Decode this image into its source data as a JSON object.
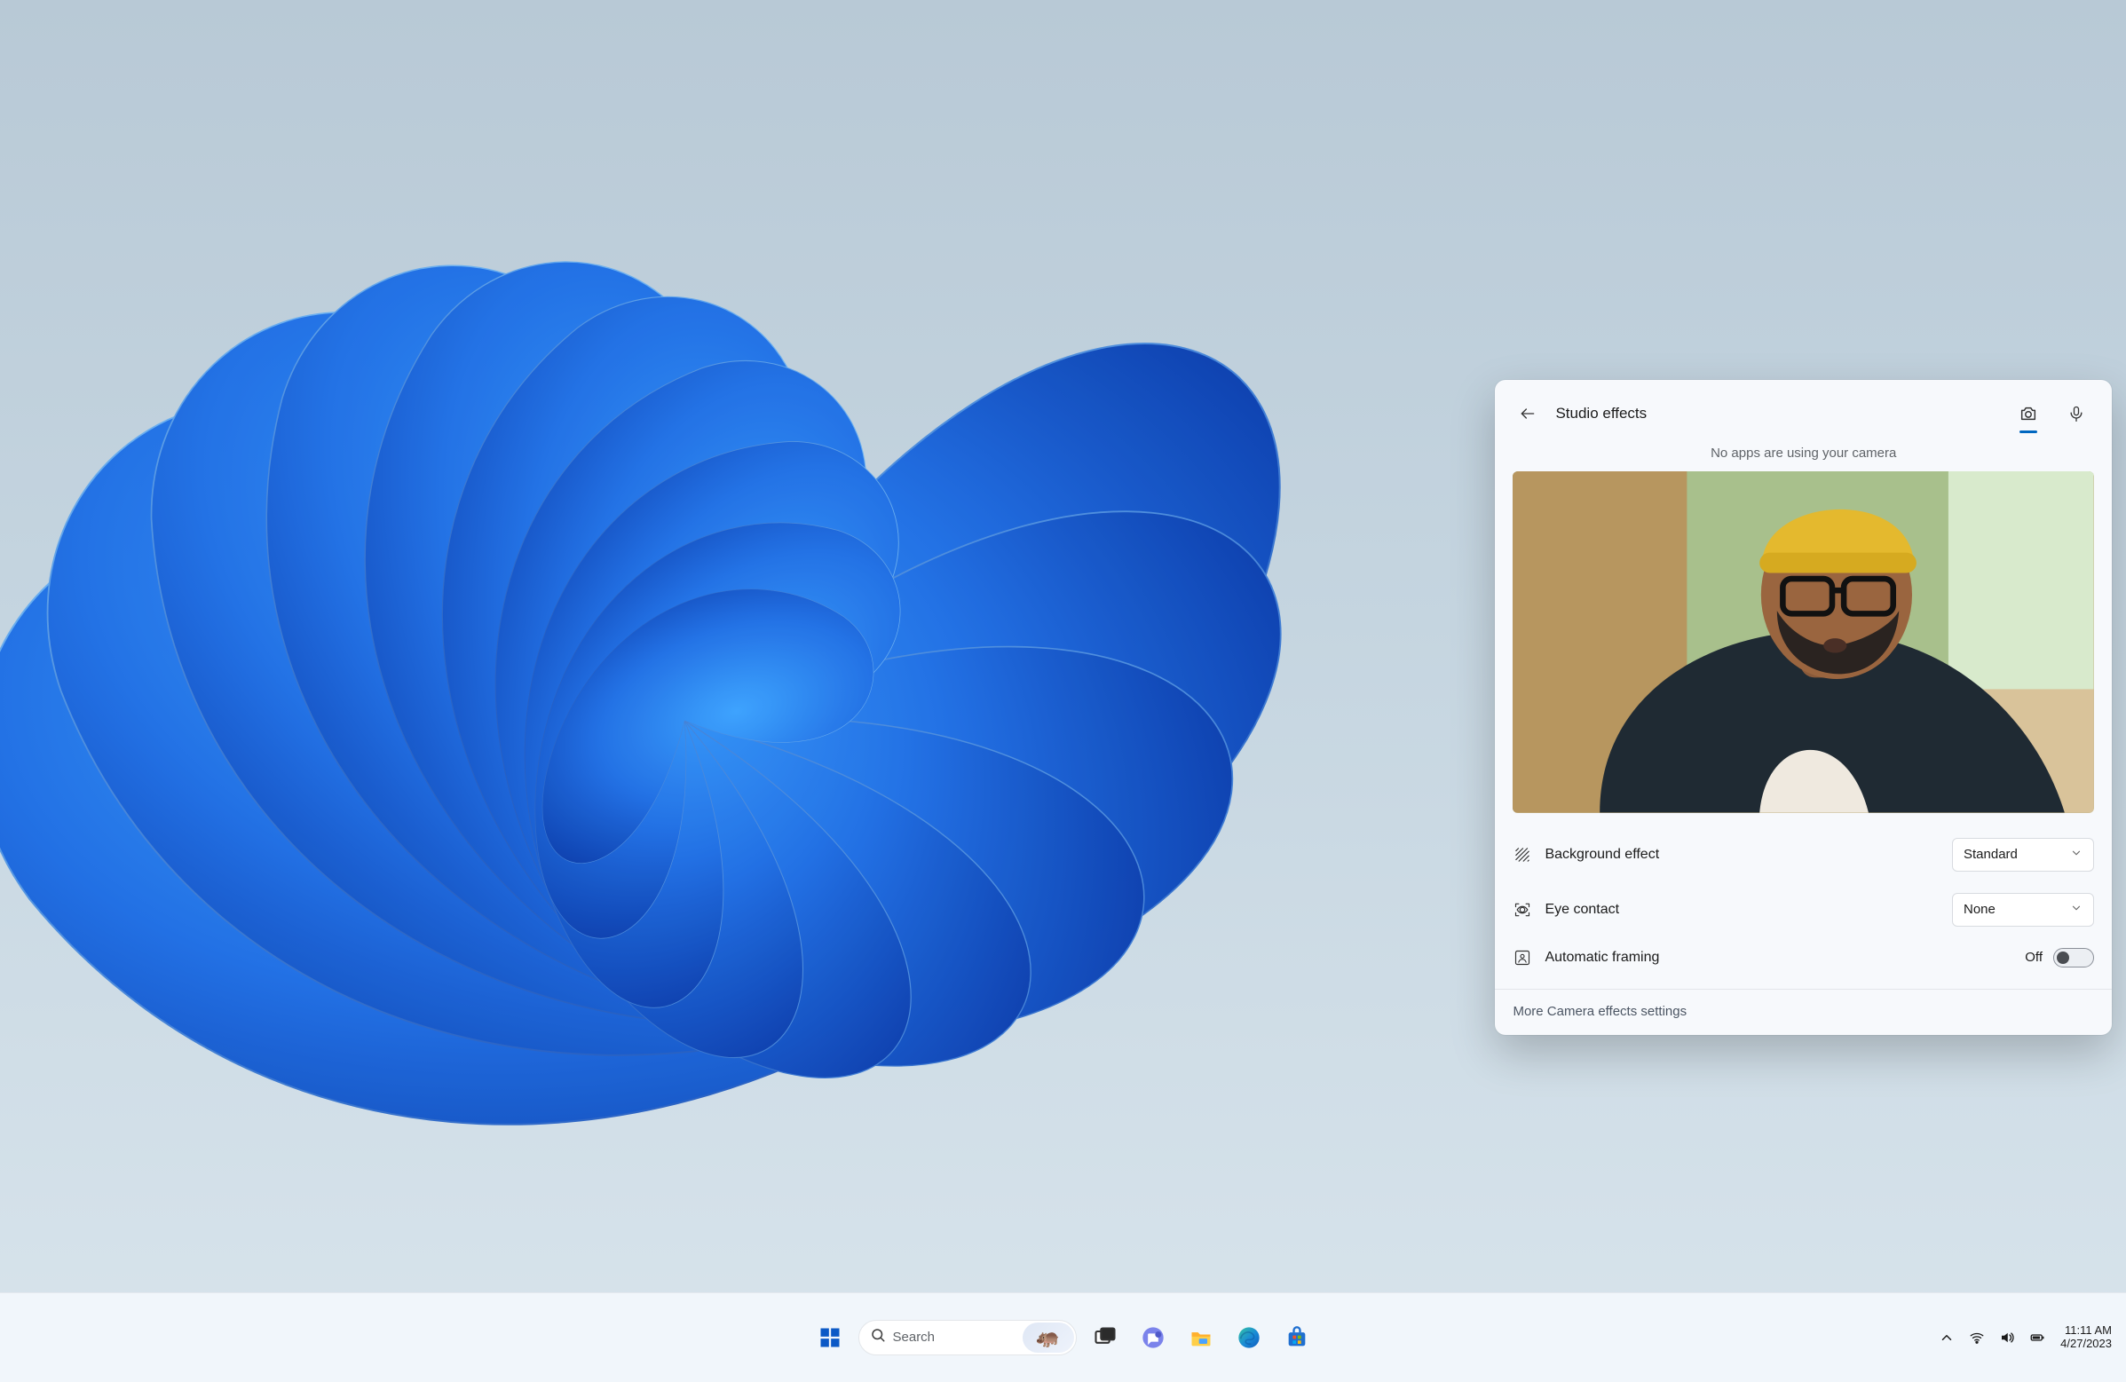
{
  "flyout": {
    "title": "Studio effects",
    "status": "No apps are using your camera",
    "settings": {
      "background": {
        "label": "Background effect",
        "value": "Standard"
      },
      "eye": {
        "label": "Eye contact",
        "value": "None"
      },
      "framing": {
        "label": "Automatic framing",
        "state_label": "Off"
      }
    },
    "more_link": "More Camera effects settings"
  },
  "taskbar": {
    "search_placeholder": "Search",
    "time": "11:11 AM",
    "date": "4/27/2023"
  }
}
